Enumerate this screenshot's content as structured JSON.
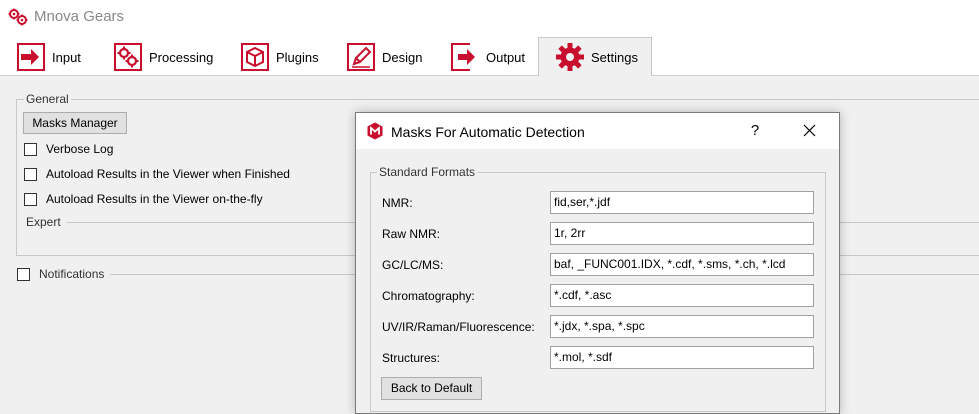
{
  "app": {
    "title": "Mnova Gears"
  },
  "tabs": [
    {
      "label": "Input",
      "icon": "input-icon"
    },
    {
      "label": "Processing",
      "icon": "processing-gears-icon"
    },
    {
      "label": "Plugins",
      "icon": "plugins-box-icon"
    },
    {
      "label": "Design",
      "icon": "design-pencil-icon"
    },
    {
      "label": "Output",
      "icon": "output-icon"
    },
    {
      "label": "Settings",
      "icon": "settings-gear-icon",
      "active": true
    }
  ],
  "settings": {
    "general_label": "General",
    "masks_manager_button": "Masks Manager",
    "checkboxes": [
      {
        "label": "Verbose Log",
        "checked": false
      },
      {
        "label": "Autoload Results in the Viewer when Finished",
        "checked": false
      },
      {
        "label": "Autoload Results in the Viewer on-the-fly",
        "checked": false
      }
    ],
    "expert_label": "Expert",
    "notifications": {
      "label": "Notifications",
      "checked": false
    }
  },
  "dialog": {
    "title": "Masks For Automatic Detection",
    "help": "?",
    "group_label": "Standard Formats",
    "fields": [
      {
        "label": "NMR:",
        "value": "fid,ser,*.jdf"
      },
      {
        "label": "Raw NMR:",
        "value": "1r, 2rr"
      },
      {
        "label": "GC/LC/MS:",
        "value": "baf, _FUNC001.IDX, *.cdf, *.sms, *.ch, *.lcd"
      },
      {
        "label": "Chromatography:",
        "value": "*.cdf, *.asc"
      },
      {
        "label": "UV/IR/Raman/Fluorescence:",
        "value": "*.jdx, *.spa, *.spc"
      },
      {
        "label": "Structures:",
        "value": "*.mol, *.sdf"
      }
    ],
    "back_to_default_button": "Back to Default"
  },
  "colors": {
    "accent_red": "#c8102e",
    "pane_bg": "#f0f0f0"
  }
}
